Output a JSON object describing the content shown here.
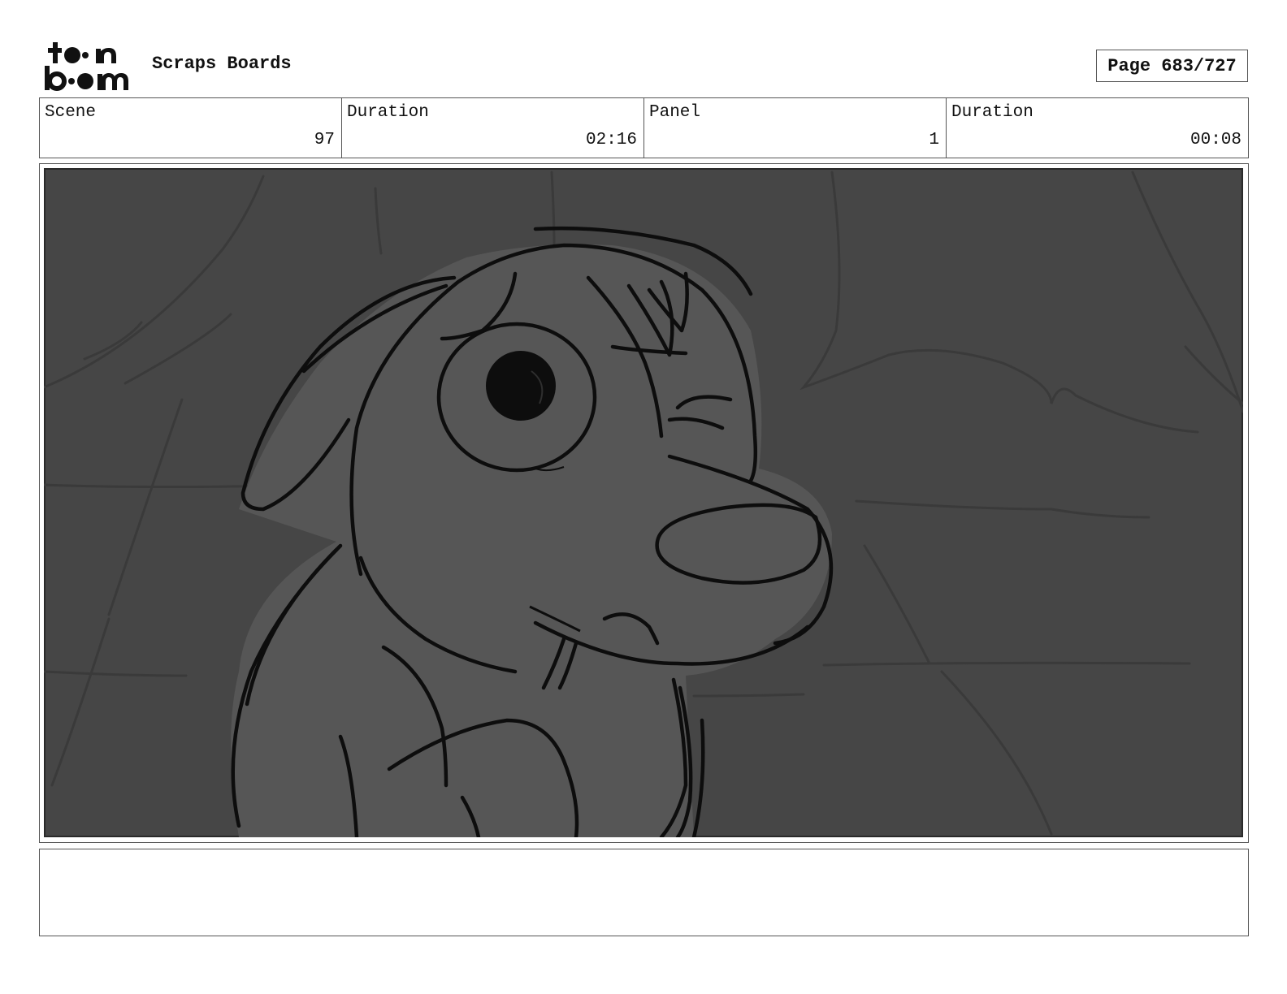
{
  "header": {
    "logo_text": "toonboom",
    "title": "Scraps Boards",
    "page": "Page 683/727"
  },
  "info": [
    {
      "label": "Scene",
      "value": "97"
    },
    {
      "label": "Duration",
      "value": "02:16"
    },
    {
      "label": "Panel",
      "value": "1"
    },
    {
      "label": "Duration",
      "value": "00:08"
    }
  ],
  "panel": {
    "description": "",
    "colors": {
      "background": "#464646",
      "character_fill": "#565656",
      "ink": "#0d0d0d"
    }
  },
  "notes": {
    "text": ""
  }
}
